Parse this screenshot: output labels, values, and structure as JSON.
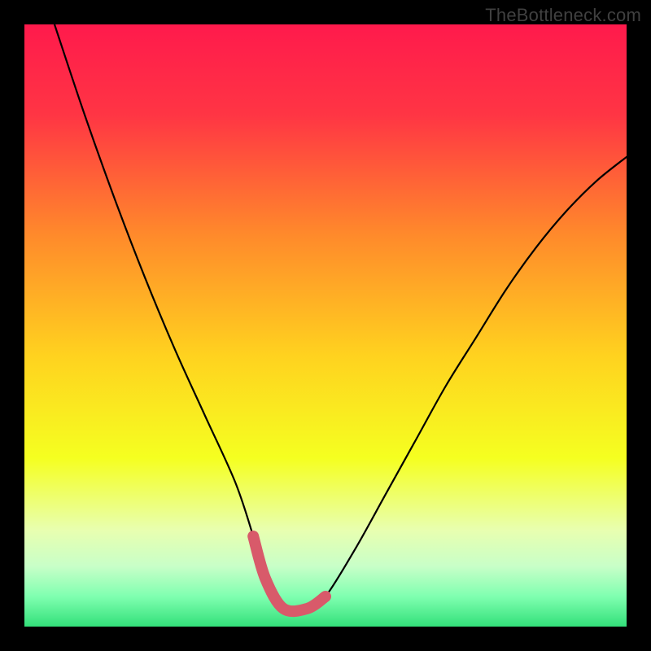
{
  "watermark": "TheBottleneck.com",
  "chart_data": {
    "type": "line",
    "title": "",
    "xlabel": "",
    "ylabel": "",
    "xlim": [
      0,
      100
    ],
    "ylim": [
      0,
      100
    ],
    "series": [
      {
        "name": "bottleneck-curve",
        "x": [
          5,
          10,
          15,
          20,
          25,
          30,
          35,
          38,
          40,
          43,
          47,
          50,
          55,
          60,
          65,
          70,
          75,
          80,
          85,
          90,
          95,
          100
        ],
        "y": [
          100,
          85,
          71,
          58,
          46,
          35,
          24,
          15,
          8,
          3,
          3,
          5,
          13,
          22,
          31,
          40,
          48,
          56,
          63,
          69,
          74,
          78
        ]
      },
      {
        "name": "optimal-region-highlight",
        "x": [
          38,
          40,
          43,
          47,
          50
        ],
        "y": [
          15,
          8,
          3,
          3,
          5
        ]
      }
    ],
    "gradient_stops": [
      {
        "offset": 0.0,
        "color": "#ff1a4c"
      },
      {
        "offset": 0.15,
        "color": "#ff3544"
      },
      {
        "offset": 0.35,
        "color": "#ff8a2b"
      },
      {
        "offset": 0.55,
        "color": "#ffd21f"
      },
      {
        "offset": 0.72,
        "color": "#f5ff20"
      },
      {
        "offset": 0.84,
        "color": "#e8ffb0"
      },
      {
        "offset": 0.9,
        "color": "#c8ffc8"
      },
      {
        "offset": 0.95,
        "color": "#7fffb0"
      },
      {
        "offset": 1.0,
        "color": "#33e07a"
      }
    ]
  }
}
